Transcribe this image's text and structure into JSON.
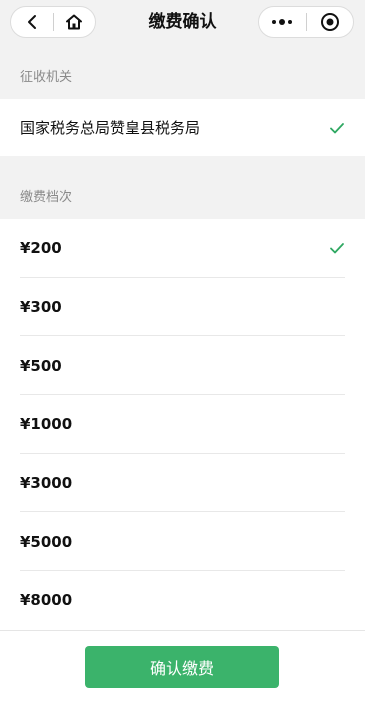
{
  "nav": {
    "title": "缴费确认"
  },
  "authority": {
    "section_label": "征收机关",
    "name": "国家税务总局赞皇县税务局",
    "selected": true
  },
  "levels": {
    "section_label": "缴费档次",
    "items": [
      {
        "amount": "¥200",
        "selected": true
      },
      {
        "amount": "¥300",
        "selected": false
      },
      {
        "amount": "¥500",
        "selected": false
      },
      {
        "amount": "¥1000",
        "selected": false
      },
      {
        "amount": "¥3000",
        "selected": false
      },
      {
        "amount": "¥5000",
        "selected": false
      },
      {
        "amount": "¥8000",
        "selected": false
      }
    ]
  },
  "footer": {
    "confirm_label": "确认缴费"
  },
  "colors": {
    "accent": "#3bb36b",
    "check": "#2fa862"
  },
  "icons": [
    "back-icon",
    "home-icon",
    "more-icon",
    "target-icon",
    "check-icon"
  ]
}
